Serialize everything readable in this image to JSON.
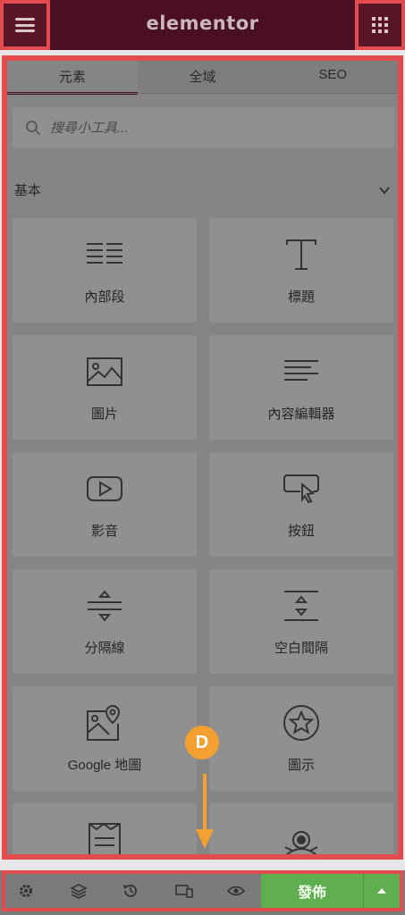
{
  "topbar": {
    "logo": "elementor"
  },
  "tabs": [
    {
      "label": "元素"
    },
    {
      "label": "全域"
    },
    {
      "label": "SEO"
    }
  ],
  "search": {
    "placeholder": "搜尋小工具..."
  },
  "section": {
    "title": "基本"
  },
  "widgets": [
    {
      "label": "內部段",
      "icon": "inner-section-icon"
    },
    {
      "label": "標題",
      "icon": "heading-icon"
    },
    {
      "label": "圖片",
      "icon": "image-icon"
    },
    {
      "label": "內容編輯器",
      "icon": "text-editor-icon"
    },
    {
      "label": "影音",
      "icon": "video-icon"
    },
    {
      "label": "按鈕",
      "icon": "button-icon"
    },
    {
      "label": "分隔線",
      "icon": "divider-icon"
    },
    {
      "label": "空白間隔",
      "icon": "spacer-icon"
    },
    {
      "label": "Google 地圖",
      "icon": "google-maps-icon"
    },
    {
      "label": "圖示",
      "icon": "star-icon"
    }
  ],
  "bottombar": {
    "publish_label": "發佈"
  },
  "annotation": {
    "badge": "D"
  },
  "colors": {
    "brand": "#4a0f22",
    "highlight": "#e24c4e",
    "publish": "#5fae50",
    "badge": "#f3a030"
  }
}
